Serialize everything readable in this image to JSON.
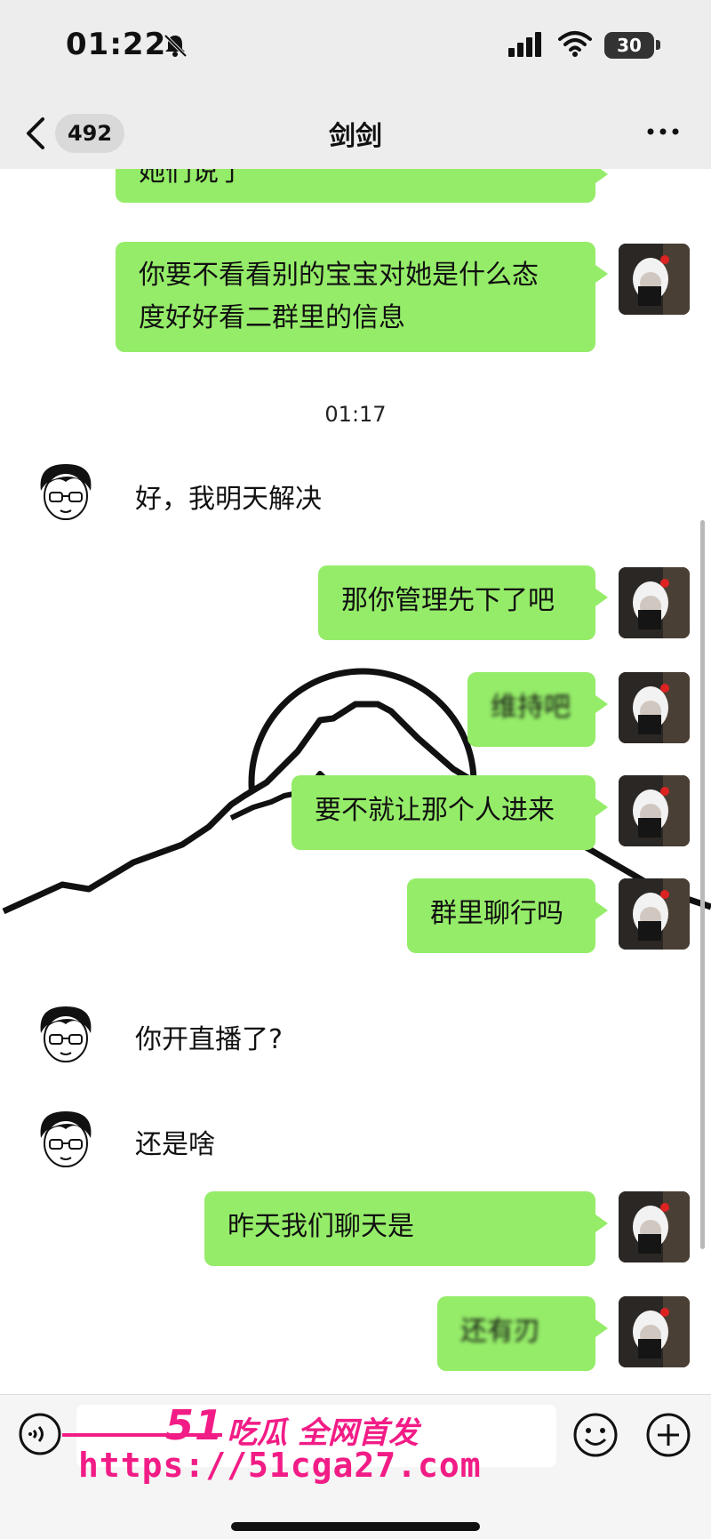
{
  "status_bar": {
    "time": "01:22",
    "battery": "30"
  },
  "header": {
    "back_count": "492",
    "title": "剑剑"
  },
  "messages": {
    "m0": "她们说了",
    "m1_line1": "你要不看看别的宝宝对她是什么态",
    "m1_line2": "度好好看二群里的信息",
    "time_sep": "01:17",
    "m2": "好，我明天解决",
    "m3": "那你管理先下了吧",
    "m4": "维持吧",
    "m5": "要不就让那个人进来",
    "m6": "群里聊行吗",
    "m7": "你开直播了?",
    "m8": "还是啥",
    "m9": "昨天我们聊天是",
    "m10": "还有刃"
  },
  "watermark": {
    "brand": "51",
    "slogan": "吃瓜 全网首发",
    "url": "https://51cga27.com"
  },
  "colors": {
    "my_bubble": "#95ec69",
    "watermark": "#f21c86",
    "bar_bg": "#ededed"
  },
  "icons": [
    "bell-muted-icon",
    "signal-icon",
    "wifi-icon",
    "battery-icon",
    "back-chevron-icon",
    "more-icon",
    "voice-icon",
    "emoji-icon",
    "plus-icon"
  ]
}
